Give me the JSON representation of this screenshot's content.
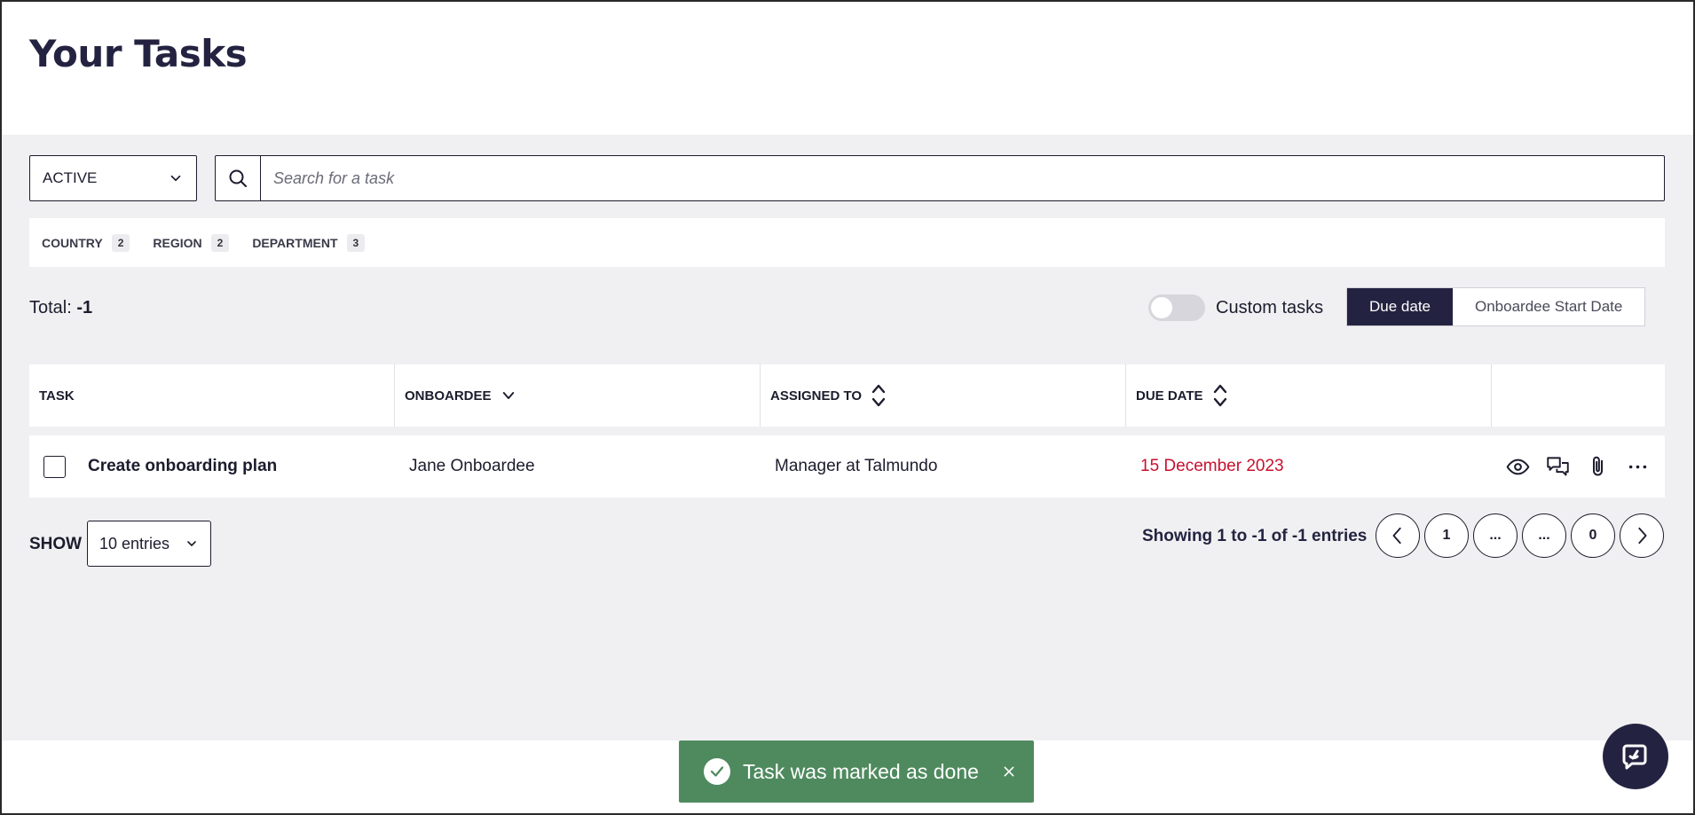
{
  "header": {
    "title": "Your Tasks"
  },
  "filters": {
    "status_value": "ACTIVE",
    "search_placeholder": "Search for a task",
    "chips": [
      {
        "label": "COUNTRY",
        "count": "2"
      },
      {
        "label": "REGION",
        "count": "2"
      },
      {
        "label": "DEPARTMENT",
        "count": "3"
      }
    ]
  },
  "summary": {
    "total_label": "Total:",
    "total_value": "-1",
    "custom_tasks_label": "Custom tasks",
    "custom_tasks_on": false,
    "sort_options": [
      "Due date",
      "Onboardee Start Date"
    ],
    "sort_active": "Due date"
  },
  "table": {
    "columns": [
      "TASK",
      "ONBOARDEE",
      "ASSIGNED TO",
      "DUE DATE"
    ],
    "rows": [
      {
        "task": "Create onboarding plan",
        "onboardee": "Jane Onboardee",
        "assigned_to": "Manager at Talmundo",
        "due_date": "15 December 2023"
      }
    ],
    "row_actions": [
      "eye-icon",
      "comments-icon",
      "paperclip-icon",
      "more-icon"
    ]
  },
  "pagination": {
    "show_label": "SHOW",
    "entries_value": "10 entries",
    "showing_text": "Showing 1 to -1 of -1 entries",
    "pages": [
      "1",
      "...",
      "...",
      "0"
    ]
  },
  "toast": {
    "message": "Task was marked as done"
  },
  "colors": {
    "primary": "#232341",
    "background": "#f0f0f2",
    "danger": "#c8102e",
    "success": "#4e8a5e"
  }
}
